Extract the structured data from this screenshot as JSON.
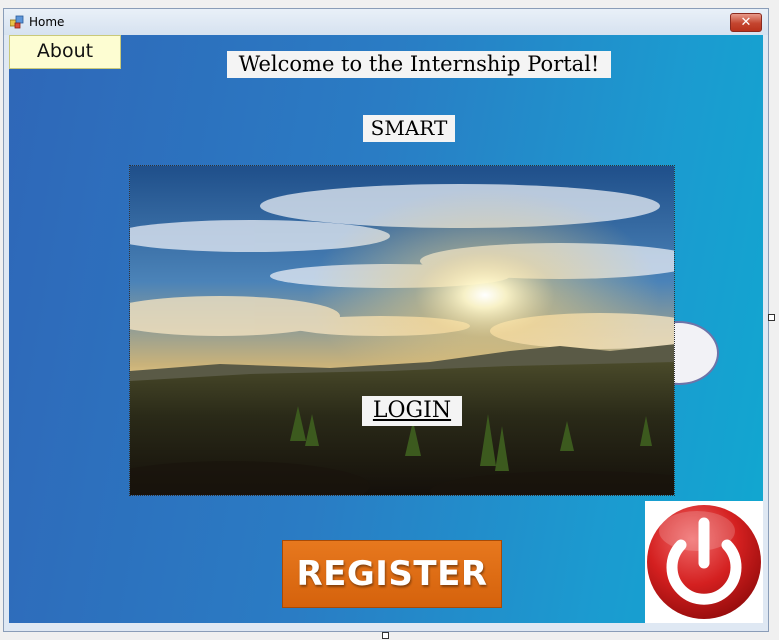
{
  "window": {
    "title": "Home",
    "close_symbol": "✕"
  },
  "icons": {
    "app": "app-form-icon",
    "close": "close-icon",
    "power": "power-icon"
  },
  "buttons": {
    "about": "About",
    "register": "REGISTER"
  },
  "labels": {
    "welcome": "Welcome to the Internship Portal!",
    "smart": "SMART",
    "login": "LOGIN"
  },
  "colors": {
    "background_start": "#2f67b8",
    "background_end": "#10a8d0",
    "register": "#e06c14",
    "power": "#d42020",
    "about_bg": "#fdfdd2"
  }
}
